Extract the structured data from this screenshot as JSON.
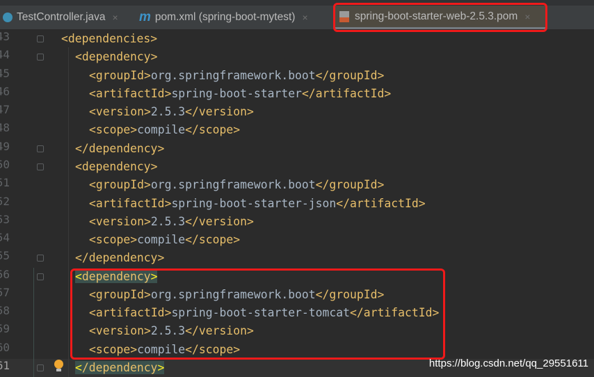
{
  "tabs": [
    {
      "label": "TestController.java",
      "icon": "java-class-icon",
      "close": "×"
    },
    {
      "label": "pom.xml (spring-boot-mytest)",
      "icon": "maven-icon",
      "icon_text": "m",
      "close": "×"
    },
    {
      "label": "spring-boot-starter-web-2.5.3.pom",
      "icon": "xml-file-icon",
      "close": "×",
      "active": true
    }
  ],
  "lines": [
    {
      "n": "43",
      "indent": 0,
      "open": "dependencies"
    },
    {
      "n": "44",
      "indent": 1,
      "open": "dependency"
    },
    {
      "n": "45",
      "indent": 2,
      "tag": "groupId",
      "value": "org.springframework.boot"
    },
    {
      "n": "46",
      "indent": 2,
      "tag": "artifactId",
      "value": "spring-boot-starter"
    },
    {
      "n": "47",
      "indent": 2,
      "tag": "version",
      "value": "2.5.3"
    },
    {
      "n": "48",
      "indent": 2,
      "tag": "scope",
      "value": "compile"
    },
    {
      "n": "49",
      "indent": 1,
      "close": "dependency"
    },
    {
      "n": "50",
      "indent": 1,
      "open": "dependency"
    },
    {
      "n": "51",
      "indent": 2,
      "tag": "groupId",
      "value": "org.springframework.boot"
    },
    {
      "n": "52",
      "indent": 2,
      "tag": "artifactId",
      "value": "spring-boot-starter-json"
    },
    {
      "n": "53",
      "indent": 2,
      "tag": "version",
      "value": "2.5.3"
    },
    {
      "n": "54",
      "indent": 2,
      "tag": "scope",
      "value": "compile"
    },
    {
      "n": "55",
      "indent": 1,
      "close": "dependency"
    },
    {
      "n": "56",
      "indent": 1,
      "open": "dependency",
      "highlight": true
    },
    {
      "n": "57",
      "indent": 2,
      "tag": "groupId",
      "value": "org.springframework.boot"
    },
    {
      "n": "58",
      "indent": 2,
      "tag": "artifactId",
      "value": "spring-boot-starter-tomcat"
    },
    {
      "n": "59",
      "indent": 2,
      "tag": "version",
      "value": "2.5.3"
    },
    {
      "n": "60",
      "indent": 2,
      "tag": "scope",
      "value": "compile"
    },
    {
      "n": "61",
      "indent": 1,
      "close": "dependency",
      "highlight": true,
      "current": true
    }
  ],
  "watermark": "https://blog.csdn.net/qq_29551611"
}
